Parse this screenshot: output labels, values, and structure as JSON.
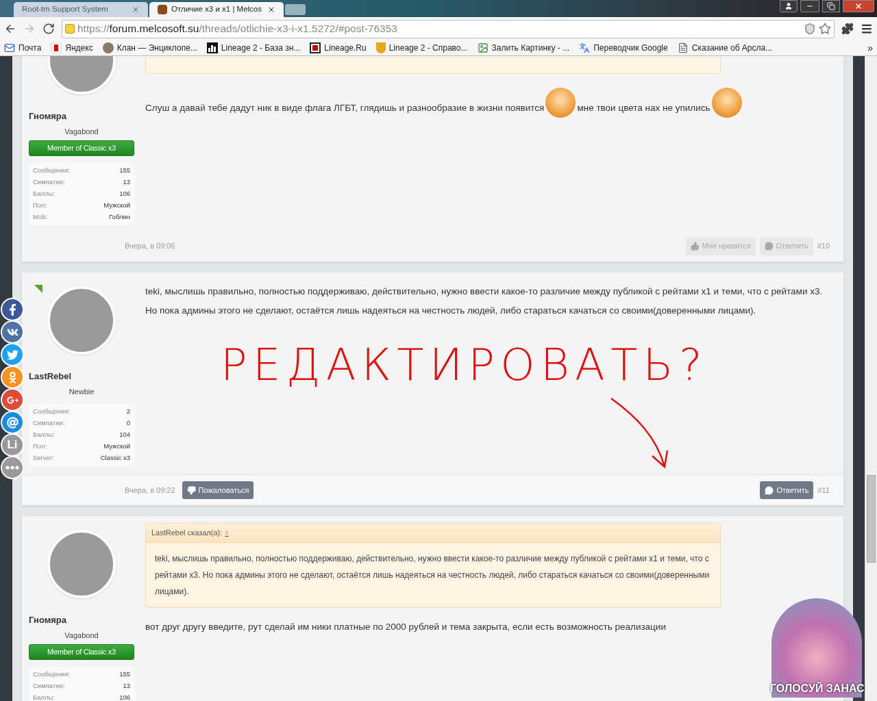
{
  "browser": {
    "tabs": [
      {
        "title": "Root-tm Support System",
        "selected": false
      },
      {
        "title": "Отличие x3 и x1 | Melcos",
        "selected": true
      }
    ],
    "address": {
      "scheme": "https://",
      "host": "forum.melcosoft.su",
      "path": "/threads/otlichie-x3-i-x1.5272/#post-76353"
    },
    "bookmarks": [
      {
        "kind": "mail",
        "label": "Почта"
      },
      {
        "kind": "yandex",
        "label": "Яндекс"
      },
      {
        "kind": "clan",
        "label": "Клан — Энциклопе..."
      },
      {
        "kind": "db",
        "label": "Lineage 2 - База зн..."
      },
      {
        "kind": "l",
        "label": "Lineage.Ru"
      },
      {
        "kind": "help",
        "label": "Lineage 2 - Справо..."
      },
      {
        "kind": "upload",
        "label": "Залить Картинку - ..."
      },
      {
        "kind": "translate",
        "label": "Переводчик Google"
      },
      {
        "kind": "page",
        "label": "Сказание об Арсла..."
      }
    ],
    "more": "»"
  },
  "social": [
    {
      "kind": "facebook",
      "color": "#3b5998"
    },
    {
      "kind": "vk",
      "color": "#4c75a3"
    },
    {
      "kind": "twitter",
      "color": "#1da1f2"
    },
    {
      "kind": "ok",
      "color": "#f7931e"
    },
    {
      "kind": "google",
      "color": "#dd4b39"
    },
    {
      "kind": "mail",
      "color": "#168de2"
    },
    {
      "kind": "text",
      "label": "Li",
      "color": "#999999"
    },
    {
      "kind": "more",
      "color": "#999999"
    }
  ],
  "posts": [
    {
      "author": "Гномяра",
      "title": "Vagabond",
      "banner": "Member of Classic x3",
      "online": false,
      "cut_quote": true,
      "stats": [
        {
          "label": "Сообщения:",
          "value": "155"
        },
        {
          "label": "Симпатии:",
          "value": "13"
        },
        {
          "label": "Баллы:",
          "value": "106"
        },
        {
          "label": "Пол:",
          "value": "Мужской"
        },
        {
          "label": "Mob:",
          "value": "Гоблин"
        }
      ],
      "body": [
        {
          "kind": "text",
          "text": "Слуш а давай тебе дадут ник в виде флага ЛГБТ, глядишь и разнообразие в жизни появится"
        },
        {
          "kind": "smiley"
        },
        {
          "kind": "text",
          "text": "мне твои цвета нах не упились"
        },
        {
          "kind": "smiley"
        }
      ],
      "date": "Вчера, в 09:06",
      "actions": [
        {
          "kind": "like",
          "label": "Мне нравится",
          "dimmed": true
        },
        {
          "kind": "reply",
          "label": "Ответить",
          "dimmed": true
        }
      ],
      "number": "#10",
      "highlight_footer": false
    },
    {
      "author": "LastRebel",
      "title": "Newbie",
      "online": true,
      "stats": [
        {
          "label": "Сообщения:",
          "value": "2"
        },
        {
          "label": "Симпатии:",
          "value": "0"
        },
        {
          "label": "Баллы:",
          "value": "104"
        },
        {
          "label": "Пол:",
          "value": "Мужской"
        },
        {
          "label": "Server:",
          "value": "Classic x3"
        }
      ],
      "body": [
        {
          "kind": "text",
          "text": "teki, мыслишь правильно, полностью поддерживаю, действительно, нужно ввести какое-то различие между публикой с рейтами x1 и теми, что с рейтами x3. Но пока админы этого не сделают, остаётся лишь надеяться на честность людей, либо стараться качаться со своими(доверенными лицами)."
        }
      ],
      "scribble": "РЕДАКТИРОВАТЬ?",
      "date": "Вчера, в 09:22",
      "report": "Пожаловаться",
      "actions": [
        {
          "kind": "reply",
          "label": "Ответить",
          "dimmed": false
        }
      ],
      "number": "#11",
      "highlight_footer": true
    },
    {
      "author": "Гномяра",
      "title": "Vagabond",
      "banner": "Member of Classic x3",
      "online": false,
      "stats": [
        {
          "label": "Сообщения:",
          "value": "155"
        },
        {
          "label": "Симпатии:",
          "value": "13"
        },
        {
          "label": "Баллы:",
          "value": "106"
        }
      ],
      "quote": {
        "author": "LastRebel сказал(а):",
        "link": "↑",
        "text": "teki, мыслишь правильно, полностью поддерживаю, действительно, нужно ввести какое-то различие между публикой с рейтами x1 и теми, что с рейтами x3. Но пока админы этого не сделают, остаётся лишь надеяться на честность людей, либо стараться качаться со своими(доверенными лицами)."
      },
      "body": [
        {
          "kind": "text",
          "text": "вот друг другу введите, рут сделай им ники платные по 2000 рублей и тема закрыта, если есть возможность реализации"
        }
      ]
    }
  ],
  "vote_banner": {
    "left": "ГОЛОСУЙ ЗА",
    "right": "НАС"
  }
}
